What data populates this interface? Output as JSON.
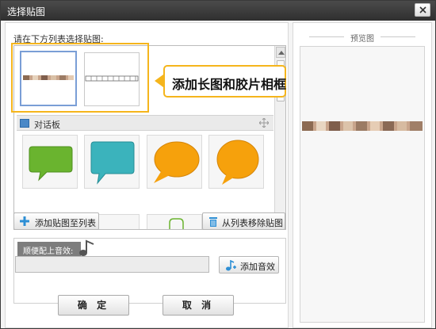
{
  "window": {
    "title": "选择贴图"
  },
  "list": {
    "prompt": "请在下方列表选择贴图:",
    "group_label": "对话板"
  },
  "callout": {
    "text": "添加长图和胶片相框"
  },
  "actions": {
    "add_label": "添加贴图至列表",
    "remove_label": "从列表移除贴图"
  },
  "sound": {
    "tag_label": "顺便配上音效:",
    "add_sound_label": "添加音效",
    "value": ""
  },
  "footer": {
    "ok_label": "确 定",
    "cancel_label": "取 消"
  },
  "preview": {
    "title": "预览图"
  },
  "colors": {
    "accent": "#f5b51c",
    "titlebar": "#3a3a3a",
    "bubble_green": "#6ab42f",
    "bubble_teal": "#3bb3bc",
    "bubble_orange": "#f6a10c"
  },
  "icons": [
    "close-icon",
    "gallery-icon",
    "move-icon",
    "plus-icon",
    "trash-icon",
    "music-note-icon",
    "add-audio-icon"
  ]
}
